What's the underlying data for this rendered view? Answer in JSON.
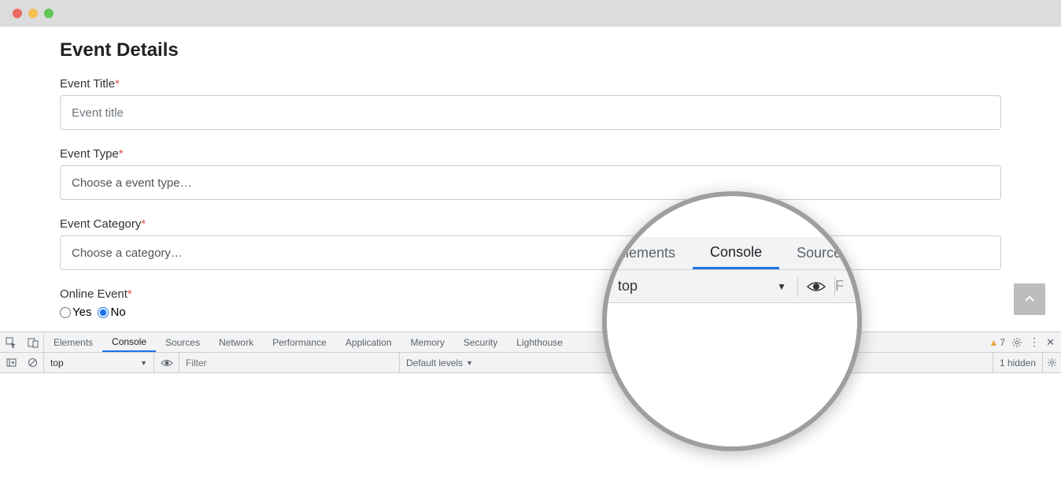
{
  "titlebar": {
    "red": "#ed6a5e",
    "yellow": "#f4bf4f",
    "green": "#62c655"
  },
  "page": {
    "title": "Event Details"
  },
  "fields": {
    "title": {
      "label": "Event Title",
      "placeholder": "Event title"
    },
    "type": {
      "label": "Event Type",
      "placeholder": "Choose a event type…"
    },
    "category": {
      "label": "Event Category",
      "placeholder": "Choose a category…"
    },
    "online": {
      "label": "Online Event",
      "yes": "Yes",
      "no": "No"
    }
  },
  "devtools": {
    "tabs": [
      "Elements",
      "Console",
      "Sources",
      "Network",
      "Performance",
      "Application",
      "Memory",
      "Security",
      "Lighthouse"
    ],
    "active_tab": "Console",
    "warn_count": "7",
    "toolbar": {
      "context": "top",
      "filter_placeholder": "Filter",
      "levels": "Default levels",
      "hidden": "1 hidden"
    }
  },
  "magnifier": {
    "tabs": {
      "elements": "Elements",
      "console": "Console",
      "sources": "Source"
    },
    "context": "top",
    "filter_hint": "F"
  }
}
